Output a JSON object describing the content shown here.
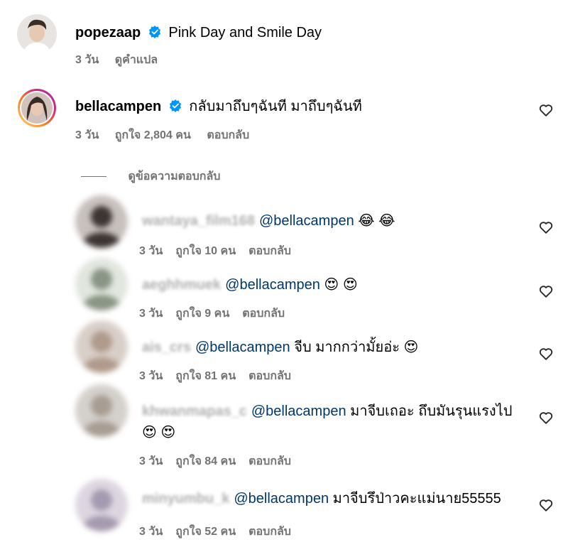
{
  "post": {
    "username": "popezaap",
    "caption": "Pink Day and Smile Day",
    "time": "3 วัน",
    "translate": "ดูคำแปล"
  },
  "top_comment": {
    "username": "bellacampen",
    "text": "กลับมาถึบๆฉันที มาถึบๆฉันที",
    "time": "3 วัน",
    "likes": "ถูกใจ 2,804 คน",
    "reply": "ตอบกลับ"
  },
  "view_replies": "ดูข้อความตอบกลับ",
  "replies": [
    {
      "username": "wantaya_film168",
      "mention": "@bellacampen",
      "text": "",
      "emojis": "😂 😂",
      "time": "3 วัน",
      "likes": "ถูกใจ 10 คน",
      "reply": "ตอบกลับ"
    },
    {
      "username": "aeghhmuek",
      "mention": "@bellacampen",
      "text": "",
      "emojis": "😍 😍",
      "time": "3 วัน",
      "likes": "ถูกใจ 9 คน",
      "reply": "ตอบกลับ"
    },
    {
      "username": "ais_crs",
      "mention": "@bellacampen",
      "text": "จีบ มากกว่ามั้ยอ่ะ",
      "emojis": "😍",
      "time": "3 วัน",
      "likes": "ถูกใจ 81 คน",
      "reply": "ตอบกลับ"
    },
    {
      "username": "khwanmapas_c",
      "mention": "@bellacampen",
      "text": "มาจีบเถอะ ถึบมันรุนแรงไป",
      "emojis": "😍 😍",
      "time": "3 วัน",
      "likes": "ถูกใจ 84 คน",
      "reply": "ตอบกลับ"
    },
    {
      "username": "minyumbu_k",
      "mention": "@bellacampen",
      "text": "มาจีบรึป่าวคะแม่นาย55555",
      "emojis": "",
      "time": "3 วัน",
      "likes": "ถูกใจ 52 คน",
      "reply": "ตอบกลับ"
    }
  ],
  "icons": {
    "verified": "verified-badge-icon",
    "heart": "heart-outline-icon"
  },
  "colors": {
    "verified": "#0095f6",
    "mention": "#00376b",
    "meta": "#737373"
  }
}
